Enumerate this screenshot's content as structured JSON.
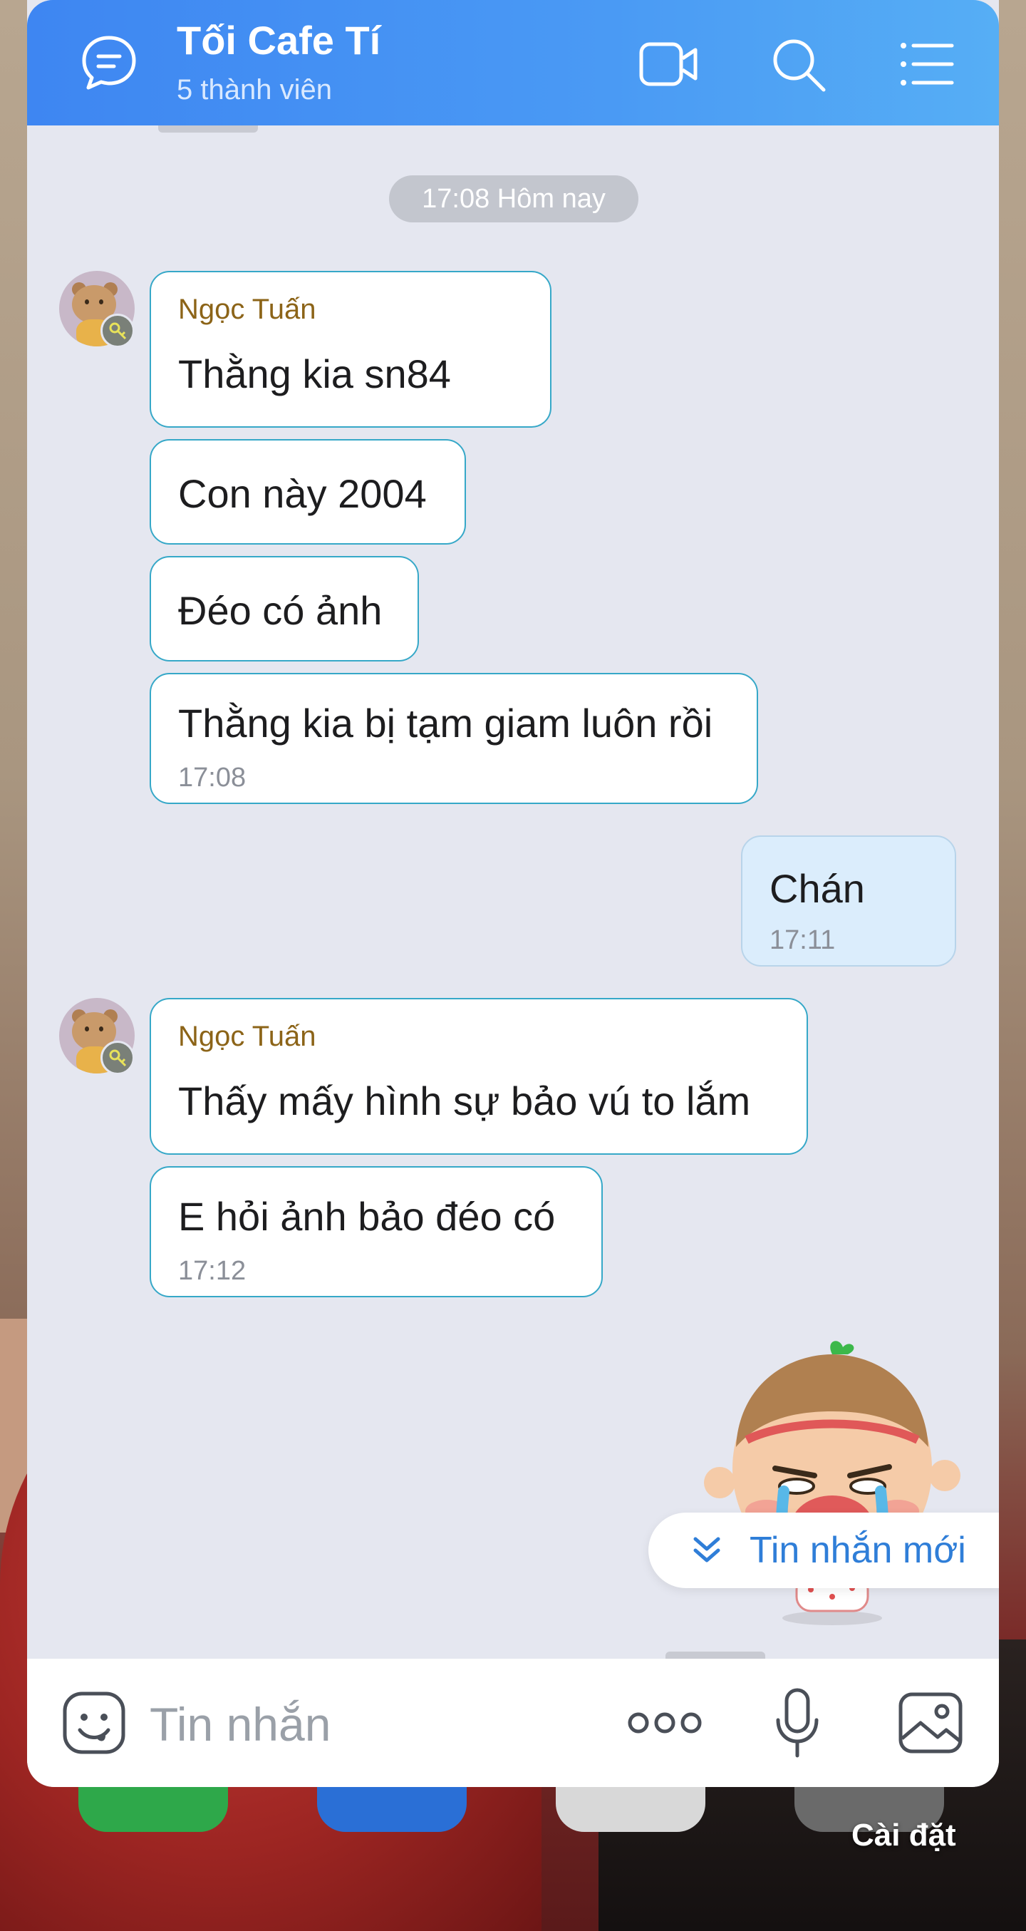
{
  "header": {
    "title": "Tối Cafe Tí",
    "subtitle": "5 thành viên"
  },
  "date_separator": "17:08 Hôm nay",
  "messages": [
    {
      "sender": "Ngọc Tuấn",
      "text": "Thằng kia sn84"
    },
    {
      "text": "Con này 2004"
    },
    {
      "text": "Đéo có ảnh"
    },
    {
      "text": "Thằng kia bị tạm giam luôn rồi",
      "time": "17:08"
    },
    {
      "text": "Chán",
      "time": "17:11",
      "mine": true
    },
    {
      "sender": "Ngọc Tuấn",
      "text": "Thấy mấy hình sự bảo vú to lắm"
    },
    {
      "text": "E hỏi ảnh bảo đéo có",
      "time": "17:12"
    }
  ],
  "new_messages_label": "Tin nhắn mới",
  "input": {
    "placeholder": "Tin nhắn"
  },
  "home_screen": {
    "settings_label": "Cài đặt"
  },
  "colors": {
    "header_start": "#3e86f2",
    "header_end": "#56aef5",
    "bubble_border": "#36a8c8",
    "sender_name": "#8c6418",
    "my_bubble": "#dbedfc",
    "accent": "#2f7ed8"
  }
}
